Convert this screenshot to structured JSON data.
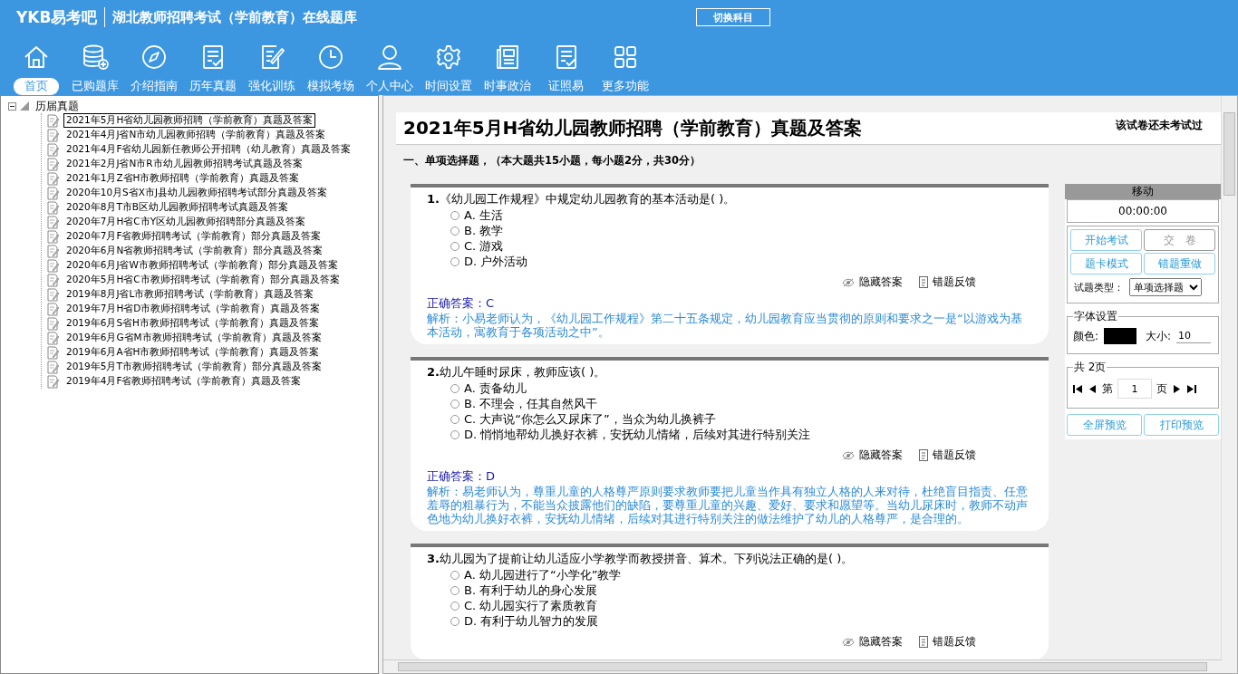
{
  "header": {
    "logo": "YKB易考吧",
    "title": "湖北教师招聘考试（学前教育）在线题库",
    "switch_button": "切换科目"
  },
  "toolbar": [
    {
      "label": "首页",
      "selected": true
    },
    {
      "label": "已购题库",
      "selected": false
    },
    {
      "label": "介绍指南",
      "selected": false
    },
    {
      "label": "历年真题",
      "selected": false
    },
    {
      "label": "强化训练",
      "selected": false
    },
    {
      "label": "模拟考场",
      "selected": false
    },
    {
      "label": "个人中心",
      "selected": false
    },
    {
      "label": "时间设置",
      "selected": false
    },
    {
      "label": "时事政治",
      "selected": false
    },
    {
      "label": "证照易",
      "selected": false
    },
    {
      "label": "更多功能",
      "selected": false
    }
  ],
  "tree": {
    "root": "历届真题",
    "expanded": true,
    "children": [
      {
        "label": "2021年5月H省幼儿园教师招聘（学前教育）真题及答案",
        "selected": true
      },
      {
        "label": "2021年4月J省N市幼儿园教师招聘（学前教育）真题及答案",
        "selected": false
      },
      {
        "label": "2021年4月F省幼儿园新任教师公开招聘（幼儿教育）真题及答案",
        "selected": false
      },
      {
        "label": "2021年2月J省N市R市幼儿园教师招聘考试真题及答案",
        "selected": false
      },
      {
        "label": "2021年1月Z省H市教师招聘（学前教育）真题及答案",
        "selected": false
      },
      {
        "label": "2020年10月S省X市J县幼儿园教师招聘考试部分真题及答案",
        "selected": false
      },
      {
        "label": "2020年8月T市B区幼儿园教师招聘考试真题及答案",
        "selected": false
      },
      {
        "label": "2020年7月H省C市Y区幼儿园教师招聘部分真题及答案",
        "selected": false
      },
      {
        "label": "2020年7月F省教师招聘考试（学前教育）部分真题及答案",
        "selected": false
      },
      {
        "label": "2020年6月N省教师招聘考试（学前教育）部分真题及答案",
        "selected": false
      },
      {
        "label": "2020年6月J省W市教师招聘考试（学前教育）部分真题及答案",
        "selected": false
      },
      {
        "label": "2020年5月H省C市教师招聘考试（学前教育）部分真题及答案",
        "selected": false
      },
      {
        "label": "2019年8月J省L市教师招聘考试（学前教育）真题及答案",
        "selected": false
      },
      {
        "label": "2019年7月H省D市教师招聘考试（学前教育）真题及答案",
        "selected": false
      },
      {
        "label": "2019年6月S省H市教师招聘考试（学前教育）真题及答案",
        "selected": false
      },
      {
        "label": "2019年6月G省M市教师招聘考试（学前教育）真题及答案",
        "selected": false
      },
      {
        "label": "2019年6月A省H市教师招聘考试（学前教育）真题及答案",
        "selected": false
      },
      {
        "label": "2019年5月T市教师招聘考试（学前教育）部分真题及答案",
        "selected": false
      },
      {
        "label": "2019年4月F省教师招聘考试（学前教育）真题及答案",
        "selected": false
      }
    ]
  },
  "paper": {
    "title": "2021年5月H省幼儿园教师招聘（学前教育）真题及答案",
    "status": "该试卷还未考试过",
    "section": "一、单项选择题，（本大题共15小题，每小题2分，共30分）",
    "questions": [
      {
        "number": "1.",
        "text": "《幼儿园工作规程》中规定幼儿园教育的基本活动是( )。",
        "options": [
          {
            "text": "A. 生活",
            "selected": false
          },
          {
            "text": "B. 教学",
            "selected": false
          },
          {
            "text": "C. 游戏",
            "selected": false
          },
          {
            "text": "D. 户外活动",
            "selected": false
          }
        ],
        "hide_answer": "隐藏答案",
        "feedback": "错题反馈",
        "answer": "正确答案：C",
        "explanation": "解析：小易老师认为，《幼儿园工作规程》第二十五条规定，幼儿园教育应当贯彻的原则和要求之一是“以游戏为基本活动，寓教育于各项活动之中”。"
      },
      {
        "number": "2.",
        "text": "幼儿午睡时尿床，教师应该(   )。",
        "options": [
          {
            "text": "A. 责备幼儿",
            "selected": false
          },
          {
            "text": "B. 不理会，任其自然风干",
            "selected": false
          },
          {
            "text": "C. 大声说“你怎么又尿床了”，当众为幼儿换裤子",
            "selected": false
          },
          {
            "text": "D. 悄悄地帮幼儿换好衣裤，安抚幼儿情绪，后续对其进行特别关注",
            "selected": false
          }
        ],
        "hide_answer": "隐藏答案",
        "feedback": "错题反馈",
        "answer": "正确答案：D",
        "explanation": "解析：易老师认为，尊重儿童的人格尊严原则要求教师要把儿童当作具有独立人格的人来对待，杜绝盲目指责、任意羞辱的粗暴行为，不能当众披露他们的缺陷，要尊重儿童的兴趣、爱好、要求和愿望等。当幼儿尿床时，教师不动声色地为幼儿换好衣裤，安抚幼儿情绪，后续对其进行特别关注的做法维护了幼儿的人格尊严，是合理的。"
      },
      {
        "number": "3.",
        "text": "幼儿园为了提前让幼儿适应小学教学而教授拼音、算术。下列说法正确的是( )。",
        "options": [
          {
            "text": "A. 幼儿园进行了“小学化”教学",
            "selected": false
          },
          {
            "text": "B. 有利于幼儿的身心发展",
            "selected": false
          },
          {
            "text": "C. 幼儿园实行了素质教育",
            "selected": false
          },
          {
            "text": "D. 有利于幼儿智力的发展",
            "selected": false
          }
        ],
        "hide_answer": "隐藏答案",
        "feedback": "错题反馈"
      }
    ]
  },
  "panel": {
    "handle": "移动",
    "timer": "00:00:00",
    "buttons": [
      {
        "label": "开始考试",
        "disabled": false
      },
      {
        "label": "交　卷",
        "disabled": true
      },
      {
        "label": "题卡模式",
        "disabled": false
      },
      {
        "label": "错题重做",
        "disabled": false
      }
    ],
    "type_label": "试题类型：",
    "type_value": "单项选择题",
    "font_group": "字体设置",
    "color_label": "颜色:",
    "color": "#000000",
    "size_label": "大小:",
    "size_value": "10",
    "pages_group": "共 2页",
    "page_prefix": "第",
    "page_value": "1",
    "page_suffix": "页",
    "preview_buttons": [
      "全屏预览",
      "打印预览"
    ]
  }
}
